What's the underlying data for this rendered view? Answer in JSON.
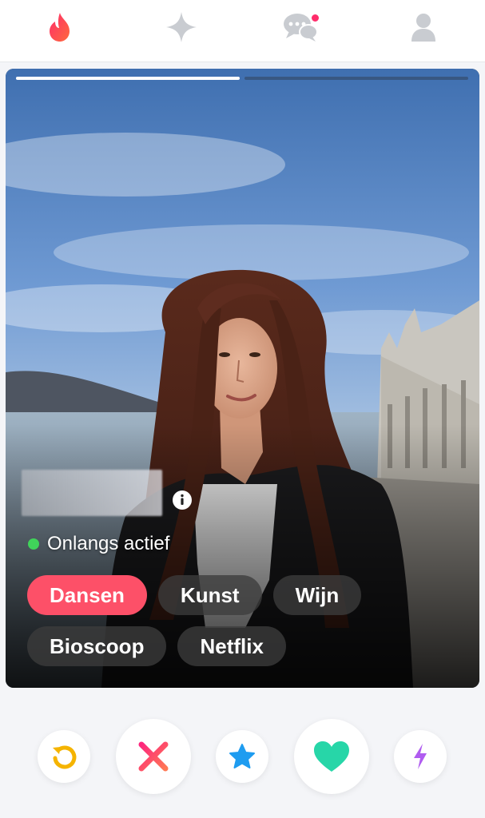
{
  "nav": {
    "items": [
      {
        "icon": "flame-icon",
        "active": true,
        "color": "#fd5068"
      },
      {
        "icon": "sparkle-icon",
        "active": false,
        "color": "#c9ccd1"
      },
      {
        "icon": "messages-icon",
        "active": false,
        "color": "#c9ccd1",
        "notification": true
      },
      {
        "icon": "profile-icon",
        "active": false,
        "color": "#c9ccd1"
      }
    ]
  },
  "card": {
    "photo_count": 2,
    "current_photo": 1,
    "status_text": "Onlangs actief",
    "status_color": "#40d35a",
    "tags": [
      {
        "label": "Dansen",
        "highlighted": true
      },
      {
        "label": "Kunst",
        "highlighted": false
      },
      {
        "label": "Wijn",
        "highlighted": false
      },
      {
        "label": "Bioscoop",
        "highlighted": false
      },
      {
        "label": "Netflix",
        "highlighted": false
      }
    ],
    "highlight_color": "#fd5068"
  },
  "actions": [
    {
      "name": "rewind",
      "icon": "rewind-icon",
      "color": "#f5b400"
    },
    {
      "name": "nope",
      "icon": "nope-x-icon",
      "color": "#fd5068"
    },
    {
      "name": "super-like",
      "icon": "star-icon",
      "color": "#1e9cf0"
    },
    {
      "name": "like",
      "icon": "heart-icon",
      "color": "#27d6a8"
    },
    {
      "name": "boost",
      "icon": "bolt-icon",
      "color": "#b05cf0"
    }
  ]
}
